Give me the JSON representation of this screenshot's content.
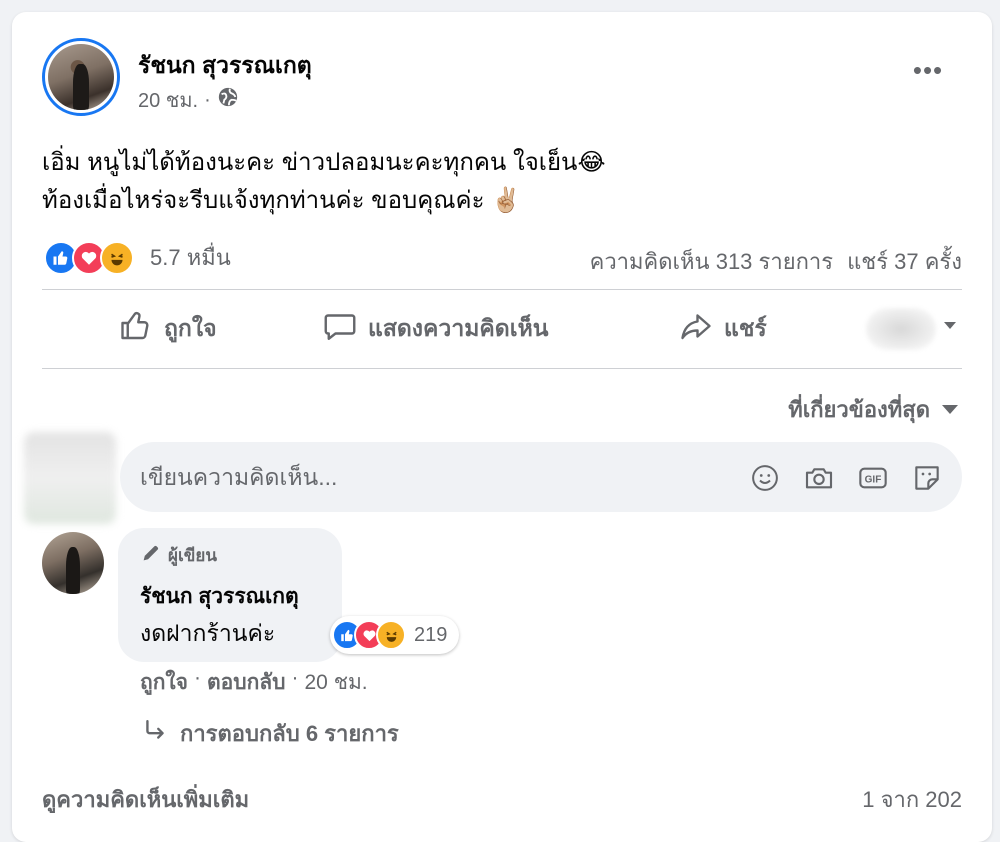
{
  "post": {
    "author": "รัชนก สุวรรณเกตุ",
    "time": "20 ชม.",
    "separator": "·",
    "audience_icon": "globe-icon",
    "lines": [
      "เอิ่ม หนูไม่ได้ท้องนะคะ ข่าวปลอมนะคะทุกคน ใจเย็น😂",
      "ท้องเมื่อไหร่จะรีบแจ้งทุกท่านค่ะ ขอบคุณค่ะ ✌🏼"
    ]
  },
  "reactions": {
    "icons": [
      "like",
      "love",
      "haha"
    ],
    "count": "5.7 หมื่น",
    "comments": "ความคิดเห็น 313 รายการ",
    "shares": "แชร์ 37 ครั้ง"
  },
  "actions": {
    "like": "ถูกใจ",
    "comment": "แสดงความคิดเห็น",
    "share": "แชร์"
  },
  "filter": {
    "label": "ที่เกี่ยวข้องที่สุด"
  },
  "composer": {
    "placeholder": "เขียนความคิดเห็น..."
  },
  "comment": {
    "badge": "ผู้เขียน",
    "author": "รัชนก สุวรรณเกตุ",
    "text": "งดฝากร้านค่ะ",
    "reaction_count": "219",
    "like": "ถูกใจ",
    "reply": "ตอบกลับ",
    "time": "20 ชม.",
    "separator": "·",
    "replies": "การตอบกลับ 6 รายการ"
  },
  "footer": {
    "more": "ดูความคิดเห็นเพิ่มเติม",
    "pager": "1 จาก 202"
  },
  "colors": {
    "accent": "#1877f2",
    "love": "#f33e58",
    "haha": "#f7b125",
    "secondary_text": "#65676b"
  }
}
